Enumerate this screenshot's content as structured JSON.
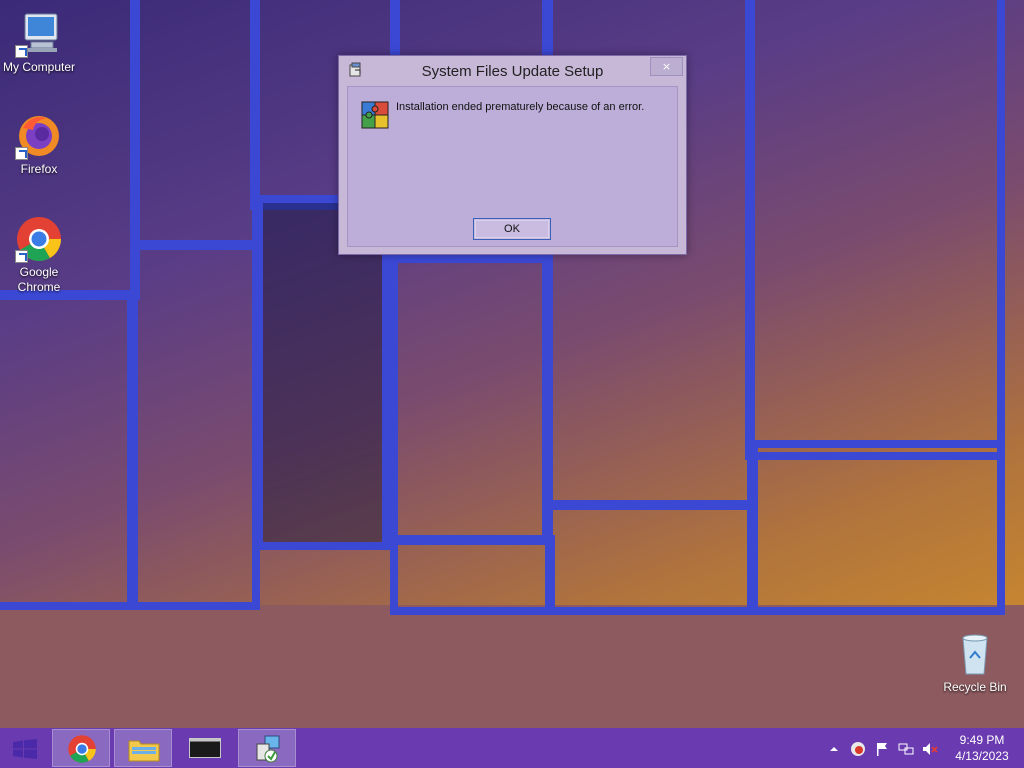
{
  "desktop": {
    "icons": [
      {
        "label": "My Computer",
        "icon": "computer-icon"
      },
      {
        "label": "Firefox",
        "icon": "firefox-icon"
      },
      {
        "label": "Google Chrome",
        "icon": "chrome-icon"
      },
      {
        "label": "Recycle Bin",
        "icon": "recycle-bin-icon"
      }
    ]
  },
  "dialog": {
    "title": "System Files Update Setup",
    "close_label": "×",
    "message": "Installation ended prematurely because of an error.",
    "ok_label": "OK",
    "icon": "installer-puzzle-icon"
  },
  "taskbar": {
    "start_icon": "windows-logo-icon",
    "pinned": [
      {
        "name": "Google Chrome",
        "icon": "chrome-icon",
        "active": true
      },
      {
        "name": "File Explorer",
        "icon": "folder-icon",
        "active": true
      },
      {
        "name": "Command Prompt",
        "icon": "terminal-icon",
        "active": false
      },
      {
        "name": "System Files Update Setup",
        "icon": "setup-icon",
        "active": true
      }
    ],
    "tray": [
      "show-hidden-icons",
      "security-icon",
      "action-center-flag-icon",
      "network-icon",
      "volume-muted-icon"
    ],
    "clock": {
      "time": "9:49 PM",
      "date": "4/13/2023"
    }
  },
  "colors": {
    "taskbar": "#6a3ab0",
    "window_frame": "#3b48d4",
    "dialog_bg": "#c7b8d8"
  }
}
